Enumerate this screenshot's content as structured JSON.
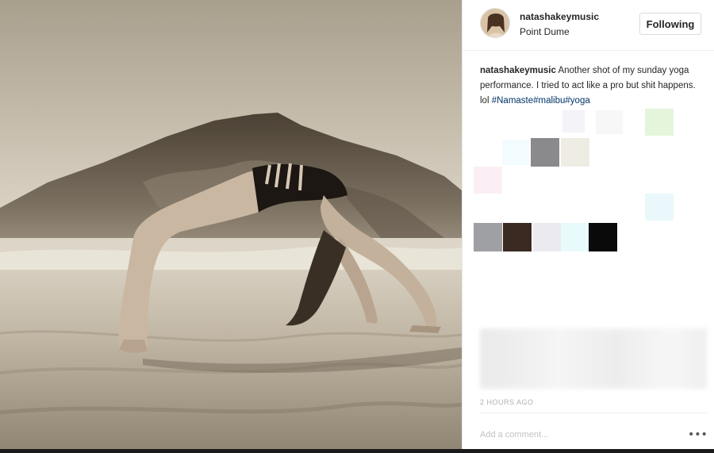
{
  "post": {
    "photo_alt": "",
    "username": "natashakeymusic",
    "location": "Point Dume",
    "follow_label": "Following",
    "caption": {
      "username": "natashakeymusic",
      "text": "Another shot of my sunday yoga performance. I tried to act like a pro but shit happens. lol",
      "hashtags": "#Namaste#malibu#yoga"
    },
    "time_ago": "2 HOURS AGO",
    "comment_placeholder": "Add a comment...",
    "more_label": "•••"
  },
  "colors": {
    "username": "#262626",
    "hashtag": "#003569",
    "border": "#dbdbdb",
    "swatches": [
      "#f3f3f8",
      "#f7f7f7",
      "#e4f5dc",
      "#f2fbfd",
      "#8a8a8c",
      "#efece4",
      "#fbeef5",
      "#eaf8fc",
      "#9fa0a4",
      "#3a2a22",
      "#ebeaf1",
      "#e8fafc",
      "#0a0a0a"
    ]
  },
  "icons": [
    "avatar",
    "more-options-icon"
  ]
}
